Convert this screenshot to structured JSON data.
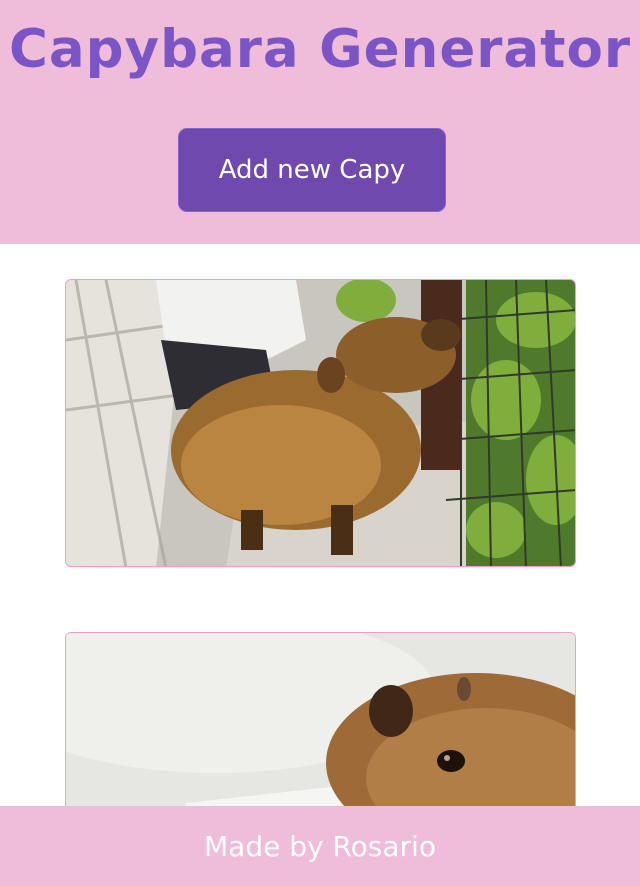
{
  "header": {
    "title": "Capybara Generator",
    "add_button_label": "Add new Capy"
  },
  "cards": [
    {
      "image": "capybara-photo-sitting-by-fence"
    },
    {
      "image": "capybara-photo-head-closeup"
    }
  ],
  "footer": {
    "text": "Made by Rosario"
  },
  "colors": {
    "header_bg": "#efbcda",
    "title": "#7b55c6",
    "button_bg": "#6f49ae",
    "card_border": "#ef9ccd",
    "footer_text": "#ffffff"
  }
}
